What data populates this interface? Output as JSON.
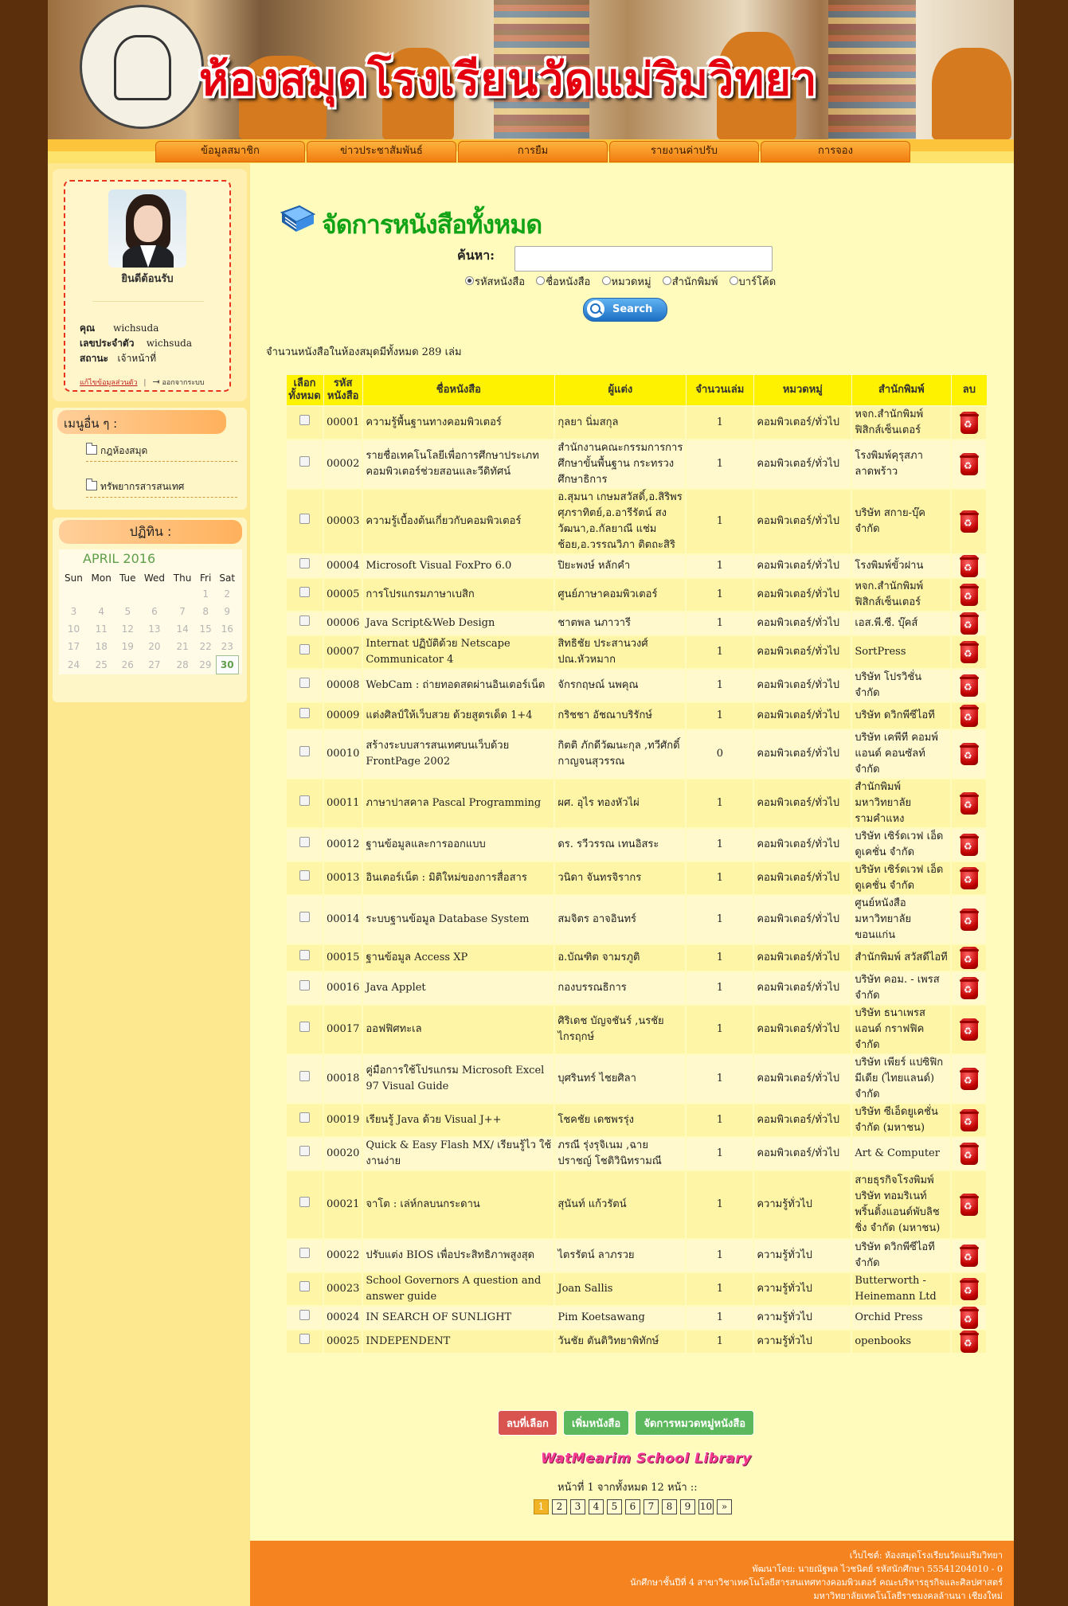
{
  "banner": {
    "title": "ห้องสมุดโรงเรียนวัดแม่ริมวิทยา"
  },
  "menu": [
    {
      "label": "ข้อมูลสมาชิก"
    },
    {
      "label": "ข่าวประชาสัมพันธ์"
    },
    {
      "label": "การยืม"
    },
    {
      "label": "รายงานค่าปรับ"
    },
    {
      "label": "การจอง"
    }
  ],
  "profile": {
    "welcome": "ยินดีต้อนรับ",
    "name_label": "คุณ",
    "name": "wichsuda",
    "id_label": "เลขประจำตัว",
    "id": "wichsuda",
    "status_label": "สถานะ",
    "status": "เจ้าหน้าที่",
    "edit_link": "แก้ไขข้อมูลส่วนตัว",
    "logout_link": "ออกจากระบบ"
  },
  "other_menu": {
    "title": "เมนูอื่น ๆ :",
    "items": [
      {
        "label": "กฎห้องสมุด"
      },
      {
        "label": "ทรัพยากรสารสนเทศ"
      }
    ]
  },
  "calendar": {
    "title": "ปฏิทิน :",
    "month": "APRIL 2016",
    "days": [
      "Sun",
      "Mon",
      "Tue",
      "Wed",
      "Thu",
      "Fri",
      "Sat"
    ],
    "weeks": [
      [
        "",
        "",
        "",
        "",
        "",
        "1",
        "2"
      ],
      [
        "3",
        "4",
        "5",
        "6",
        "7",
        "8",
        "9"
      ],
      [
        "10",
        "11",
        "12",
        "13",
        "14",
        "15",
        "16"
      ],
      [
        "17",
        "18",
        "19",
        "20",
        "21",
        "22",
        "23"
      ],
      [
        "24",
        "25",
        "26",
        "27",
        "28",
        "29",
        "30"
      ]
    ],
    "today": "30"
  },
  "main": {
    "title": "จัดการหนังสือทั้งหมด",
    "search_label": "ค้นหา:",
    "search_value": "",
    "search_options": [
      "รหัสหนังสือ",
      "ชื่อหนังสือ",
      "หมวดหมู่",
      "สำนักพิมพ์",
      "บาร์โค้ด"
    ],
    "search_selected": "รหัสหนังสือ",
    "search_button": "Search",
    "count_text": "จำนวนหนังสือในห้องสมุดมีทั้งหมด 289 เล่ม"
  },
  "table": {
    "headers": {
      "select": "เลือกทั้งหมด",
      "code": "รหัสหนังสือ",
      "title": "ชื่อหนังสือ",
      "author": "ผู้แต่ง",
      "qty": "จำนวนเล่ม",
      "category": "หมวดหมู่",
      "publisher": "สำนักพิมพ์",
      "delete": "ลบ"
    },
    "rows": [
      {
        "code": "00001",
        "title": "ความรู้พื้นฐานทางคอมพิวเตอร์",
        "author": "กุลยา นิ่มสกุล",
        "qty": "1",
        "category": "คอมพิวเตอร์/ทั่วไป",
        "publisher": "หจก.สำนักพิมพ์ ฟิสิกส์เซ็นเตอร์"
      },
      {
        "code": "00002",
        "title": "รายชื่อเทคโนโลยีเพื่อการศึกษาประเภทคอมพิวเตอร์ช่วยสอนและวีดิทัศน์",
        "author": "สำนักงานคณะกรรมการการศึกษาขั้นพื้นฐาน กระทรวงศึกษาธิการ",
        "qty": "1",
        "category": "คอมพิวเตอร์/ทั่วไป",
        "publisher": "โรงพิมพ์คุรุสภาลาดพร้าว"
      },
      {
        "code": "00003",
        "title": "ความรู้เบื้องต้นเกี่ยวกับคอมพิวเตอร์",
        "author": "อ.สุมนา เกษมสวัสดิ์,อ.สิริพร ศุภราทิตย์,อ.อารีรัตน์ สงวัฒนา,อ.กัลยาณี แช่มช้อย,อ.วรรณวิภา ติตถะสิริ",
        "qty": "1",
        "category": "คอมพิวเตอร์/ทั่วไป",
        "publisher": "บริษัท สกาย-บุ๊ค จำกัด"
      },
      {
        "code": "00004",
        "title": "Microsoft Visual FoxPro 6.0",
        "author": "ปิยะพงษ์ หลักคำ",
        "qty": "1",
        "category": "คอมพิวเตอร์/ทั่วไป",
        "publisher": "โรงพิมพ์ขั้วฝาน"
      },
      {
        "code": "00005",
        "title": "การโปรแกรมภาษาเบสิก",
        "author": "ศูนย์ภาษาคอมพิวเตอร์",
        "qty": "1",
        "category": "คอมพิวเตอร์/ทั่วไป",
        "publisher": "หจก.สำนักพิมพ์ ฟิสิกส์เซ็นเตอร์"
      },
      {
        "code": "00006",
        "title": "Java Script&Web Design",
        "author": "ชาตพล นภาวารี",
        "qty": "1",
        "category": "คอมพิวเตอร์/ทั่วไป",
        "publisher": "เอส.พี.ซี. บุ๊คส์"
      },
      {
        "code": "00007",
        "title": "Internat ปฏิบัติด้วย Netscape Communicator 4",
        "author": "สิทธิชัย ประสานวงศ์ ปณ.หัวหมาก",
        "qty": "1",
        "category": "คอมพิวเตอร์/ทั่วไป",
        "publisher": "SortPress"
      },
      {
        "code": "00008",
        "title": "WebCam : ถ่ายทอดสดผ่านอินเตอร์เน็ต",
        "author": "จักรกฤษณ์ นพคุณ",
        "qty": "1",
        "category": "คอมพิวเตอร์/ทั่วไป",
        "publisher": "บริษัท โปรวิชั่น จำกัด"
      },
      {
        "code": "00009",
        "title": "แต่งศิลป์ให้เว็บสวย ด้วยสูตรเด็ด 1+4",
        "author": "กริชชา อัชณาบริรักษ์",
        "qty": "1",
        "category": "คอมพิวเตอร์/ทั่วไป",
        "publisher": "บริษัท ดวิกพีซีไอที"
      },
      {
        "code": "00010",
        "title": "สร้างระบบสารสนเทศบนเว็บด้วย FrontPage 2002",
        "author": "กิตติ ภักดีวัฒนะกุล ,ทวีศักดิ์ กาญจนสุวรรณ",
        "qty": "0",
        "category": "คอมพิวเตอร์/ทั่วไป",
        "publisher": "บริษัท เคพีที คอมพ์ แอนด์ คอนซัลท์ จำกัด"
      },
      {
        "code": "00011",
        "title": "ภาษาปาสคาล Pascal Programming",
        "author": "ผศ. อุไร ทองหัวไผ่",
        "qty": "1",
        "category": "คอมพิวเตอร์/ทั่วไป",
        "publisher": "สำนักพิมพ์ มหาวิทยาลัยรามคำแหง"
      },
      {
        "code": "00012",
        "title": "ฐานข้อมูลและการออกแบบ",
        "author": "ดร. รวีวรรณ เทนอิสระ",
        "qty": "1",
        "category": "คอมพิวเตอร์/ทั่วไป",
        "publisher": "บริษัท เซิร์ดเวฟ เอ็ดดูเคชั่น จำกัด"
      },
      {
        "code": "00013",
        "title": "อินเตอร์เน็ต : มิติใหม่ของการสื่อสาร",
        "author": "วนิดา จันทรจิรากร",
        "qty": "1",
        "category": "คอมพิวเตอร์/ทั่วไป",
        "publisher": "บริษัท เซิร์ดเวฟ เอ็ดดูเคชั่น จำกัด"
      },
      {
        "code": "00014",
        "title": "ระบบฐานข้อมูล Database System",
        "author": "สมจิตร อาจอินทร์",
        "qty": "1",
        "category": "คอมพิวเตอร์/ทั่วไป",
        "publisher": "ศูนย์หนังสือ มหาวิทยาลัยขอนแก่น"
      },
      {
        "code": "00015",
        "title": "ฐานข้อมูล Access XP",
        "author": "อ.บัณฑิต จามรภูติ",
        "qty": "1",
        "category": "คอมพิวเตอร์/ทั่วไป",
        "publisher": "สำนักพิมพ์ สวัสดีไอที"
      },
      {
        "code": "00016",
        "title": "Java Applet",
        "author": "กองบรรณธิการ",
        "qty": "1",
        "category": "คอมพิวเตอร์/ทั่วไป",
        "publisher": "บริษัท คอม. - เพรส จำกัด"
      },
      {
        "code": "00017",
        "title": "ออฟฟิศทะเล",
        "author": "ศิริเดช บัญจชันร์ ,นรชัย ไกรฤกษ์",
        "qty": "1",
        "category": "คอมพิวเตอร์/ทั่วไป",
        "publisher": "บริษัท ธนาเพรส แอนด์ กราฟฟิค จำกัด"
      },
      {
        "code": "00018",
        "title": "คู่มือการใช้โปรแกรม Microsoft Excel 97 Visual Guide",
        "author": "บุศรินทร์ ไชยศิลา",
        "qty": "1",
        "category": "คอมพิวเตอร์/ทั่วไป",
        "publisher": "บริษัท เพียร์ แปซิฟิก มีเดีย (ไทยแลนด์) จำกัด"
      },
      {
        "code": "00019",
        "title": "เรียนรู้ Java ด้วย Visual J++",
        "author": "โชคชัย เดชพรรุ่ง",
        "qty": "1",
        "category": "คอมพิวเตอร์/ทั่วไป",
        "publisher": "บริษัท ซีเอ็ดยูเคชั่น จำกัด (มหาชน)"
      },
      {
        "code": "00020",
        "title": "Quick & Easy Flash MX/ เรียนรู้ไว ใช้งานง่าย",
        "author": "ภรณี รุ่งรุจิเนม ,ฉาย ปราชญ์ โชติวินิทรามณี",
        "qty": "1",
        "category": "คอมพิวเตอร์/ทั่วไป",
        "publisher": "Art & Computer"
      },
      {
        "code": "00021",
        "title": "จาโต : เล่ห์กลบนกระดาน",
        "author": "สุนันท์ แก้วรัตน์",
        "qty": "1",
        "category": "ความรู้ทั่วไป",
        "publisher": "สายธุรกิจโรงพิมพ์ บริษัท ทอมริเนท์ พริ้นติ้งแอนด์พับลิชชิ่ง จำกัด (มหาชน)"
      },
      {
        "code": "00022",
        "title": "ปรับแต่ง BIOS เพื่อประสิทธิภาพสูงสุด",
        "author": "ไตรรัตน์ ลาภรวย",
        "qty": "1",
        "category": "ความรู้ทั่วไป",
        "publisher": "บริษัท ดวิกพีซีไอที จำกัด"
      },
      {
        "code": "00023",
        "title": "School Governors A question and answer guide",
        "author": "Joan Sallis",
        "qty": "1",
        "category": "ความรู้ทั่วไป",
        "publisher": "Butterworth - Heinemann Ltd"
      },
      {
        "code": "00024",
        "title": "IN SEARCH OF SUNLIGHT",
        "author": "Pim Koetsawang",
        "qty": "1",
        "category": "ความรู้ทั่วไป",
        "publisher": "Orchid Press"
      },
      {
        "code": "00025",
        "title": "INDEPENDENT",
        "author": "วันชัย ตันติวิทยาพิทักษ์",
        "qty": "1",
        "category": "ความรู้ทั่วไป",
        "publisher": "openbooks"
      }
    ]
  },
  "actions": {
    "delete_selected": "ลบที่เลือก",
    "add_book": "เพิ่มหนังสือ",
    "manage_category": "จัดการหมวดหมู่หนังสือ"
  },
  "library_logo": "WatMearim School Library",
  "pagination": {
    "info": "หน้าที่ 1 จากทั้งหมด 12 หน้า ::",
    "pages": [
      "1",
      "2",
      "3",
      "4",
      "5",
      "6",
      "7",
      "8",
      "9",
      "10",
      "»"
    ],
    "current": "1"
  },
  "footer": {
    "lines": [
      "เว็บไซต์: ห้องสมุดโรงเรียนวัดแม่ริมวิทยา",
      "พัฒนาโดย: นายณัฐพล ไวชนิตย์ รหัสนักศึกษา 55541204010 - 0",
      "นักศึกษาชั้นปีที่ 4 สาขาวิชาเทคโนโลยีสารสนเทศทางคอมพิวเตอร์ คณะบริหารธุรกิจและศิลปศาสตร์",
      "มหาวิทยาลัยเทคโนโลยีราชมงคลล้านนา เชียงใหม่"
    ]
  },
  "colors": {
    "background": "#5b2f0c",
    "page": "#fde78f",
    "content": "#fffbbc",
    "header_cell": "#fff200",
    "title_green": "#12a416",
    "footer": "#f5831f"
  }
}
